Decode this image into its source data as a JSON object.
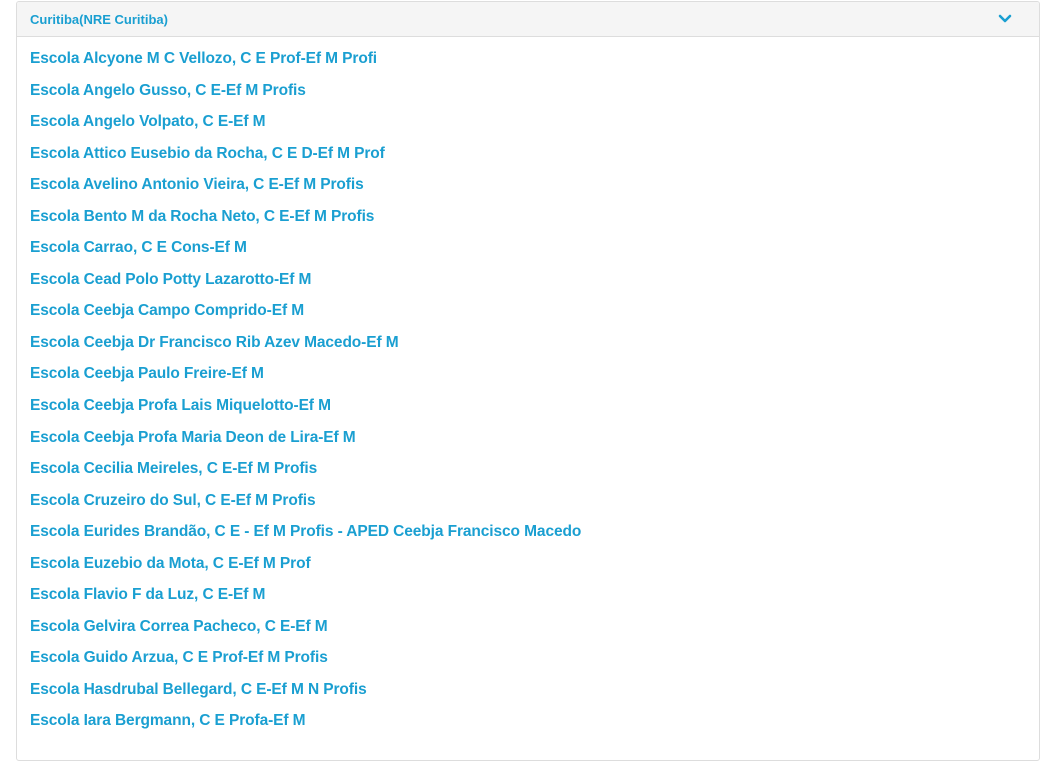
{
  "panel": {
    "title": "Curitiba(NRE Curitiba)",
    "toggle_icon": "chevron-down-icon",
    "accent_color": "#1a9fd1"
  },
  "schools": [
    "Escola Alcyone M C Vellozo, C E Prof-Ef M Profi",
    "Escola Angelo Gusso, C E-Ef M Profis",
    "Escola Angelo Volpato, C E-Ef M",
    "Escola Attico Eusebio da Rocha, C E D-Ef M Prof",
    "Escola Avelino Antonio Vieira, C E-Ef M Profis",
    "Escola Bento M da Rocha Neto, C E-Ef M Profis",
    "Escola Carrao, C E Cons-Ef M",
    "Escola Cead Polo Potty Lazarotto-Ef M",
    "Escola Ceebja Campo Comprido-Ef M",
    "Escola Ceebja Dr Francisco Rib Azev Macedo-Ef M",
    "Escola Ceebja Paulo Freire-Ef M",
    "Escola Ceebja Profa Lais Miquelotto-Ef M",
    "Escola Ceebja Profa Maria Deon de Lira-Ef M",
    "Escola Cecilia Meireles, C E-Ef M Profis",
    "Escola Cruzeiro do Sul, C E-Ef M Profis",
    "Escola Eurides Brandão, C E - Ef M Profis - APED Ceebja Francisco Macedo",
    "Escola Euzebio da Mota, C E-Ef M Prof",
    "Escola Flavio F da Luz, C E-Ef M",
    "Escola Gelvira Correa Pacheco, C E-Ef M",
    "Escola Guido Arzua, C E Prof-Ef M Profis",
    "Escola Hasdrubal Bellegard, C E-Ef M N Profis",
    "Escola Iara Bergmann, C E Profa-Ef M"
  ]
}
